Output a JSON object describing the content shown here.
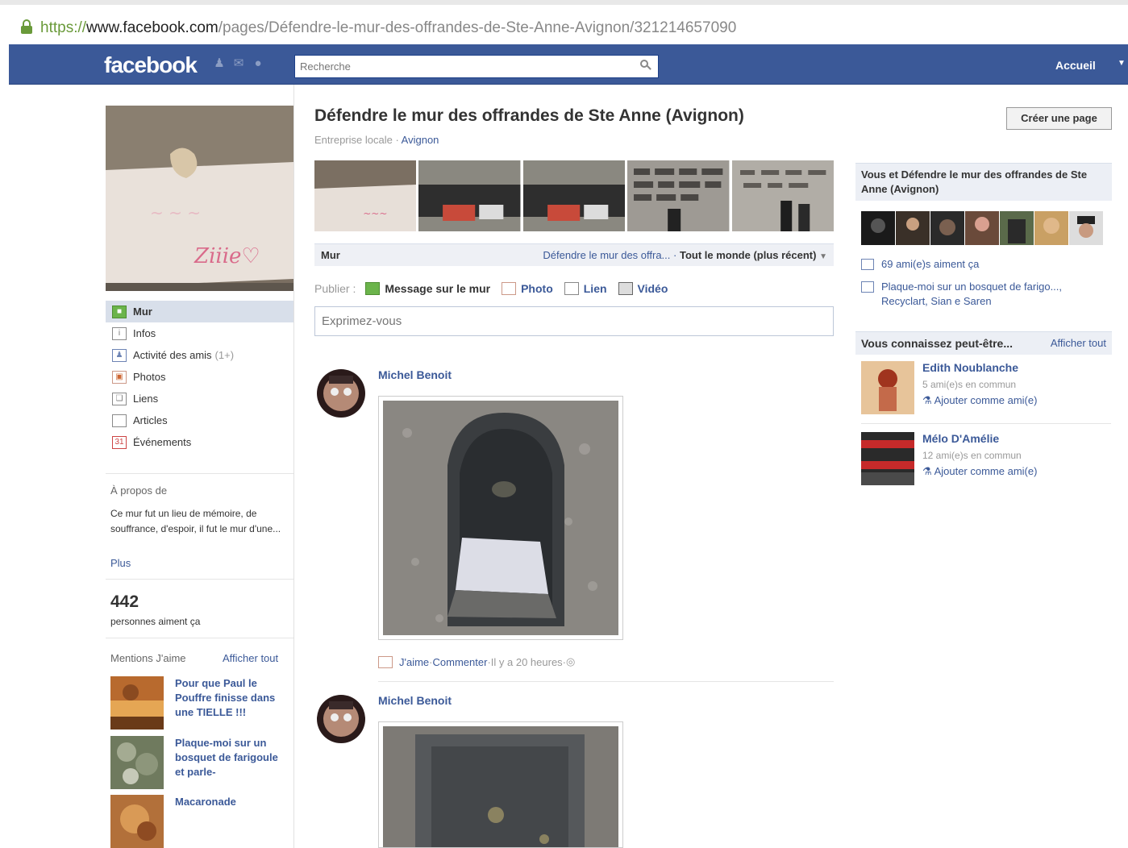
{
  "browser": {
    "url_scheme": "https://",
    "url_host": "www.facebook.com",
    "url_path": "/pages/Défendre-le-mur-des-offrandes-de-Ste-Anne-Avignon/321214657090"
  },
  "header": {
    "logo": "facebook",
    "search_placeholder": "Recherche",
    "home_label": "Accueil"
  },
  "left_nav": [
    {
      "label": "Mur",
      "icon": "wall-icon",
      "count": ""
    },
    {
      "label": "Infos",
      "icon": "info-icon",
      "count": ""
    },
    {
      "label": "Activité des amis",
      "icon": "friends-icon",
      "count": "(1+)"
    },
    {
      "label": "Photos",
      "icon": "photos-icon",
      "count": ""
    },
    {
      "label": "Liens",
      "icon": "links-icon",
      "count": ""
    },
    {
      "label": "Articles",
      "icon": "notes-icon",
      "count": ""
    },
    {
      "label": "Événements",
      "icon": "events-icon",
      "count": ""
    }
  ],
  "about": {
    "title": "À propos de",
    "text": "Ce mur fut un lieu de mémoire, de souffrance, d'espoir, il fut le mur d'une...",
    "more": "Plus"
  },
  "likes": {
    "count": "442",
    "label": "personnes aiment ça"
  },
  "mentions": {
    "title": "Mentions J'aime",
    "see_all": "Afficher tout",
    "items": [
      {
        "title": "Pour que Paul le Pouffre finisse dans une TIELLE !!!"
      },
      {
        "title": "Plaque-moi sur un bosquet de farigoule et parle-"
      },
      {
        "title": "Macaronade"
      }
    ]
  },
  "page": {
    "title": "Défendre le mur des offrandes de Ste Anne (Avignon)",
    "category": "Entreprise locale",
    "sep": " · ",
    "city": "Avignon",
    "create_page": "Créer une page"
  },
  "wall": {
    "tab": "Mur",
    "filter_link": "Défendre le mur des offra...",
    "filter_sep": " · ",
    "filter_current": "Tout le monde (plus récent)",
    "publish_label": "Publier :",
    "publish_options": [
      "Message sur le mur",
      "Photo",
      "Lien",
      "Vidéo"
    ],
    "composer_placeholder": "Exprimez-vous"
  },
  "posts": [
    {
      "author": "Michel Benoit",
      "like": "J'aime",
      "comment": "Commenter",
      "time": "Il y a 20 heures",
      "sep": " · "
    },
    {
      "author": "Michel Benoit"
    }
  ],
  "right": {
    "you_and_page": "Vous et Défendre le mur des offrandes de Ste Anne (Avignon)",
    "friends_like": "69 ami(e)s aiment ça",
    "liked_page": "Plaque-moi sur un bosquet de farigo..., Recyclart, Sian e Saren",
    "suggest_title": "Vous connaissez peut-être...",
    "suggest_see_all": "Afficher tout",
    "suggestions": [
      {
        "name": "Edith Noublanche",
        "mutual": "5 ami(e)s en commun",
        "add": "Ajouter comme ami(e)"
      },
      {
        "name": "Mélo D'Amélie",
        "mutual": "12 ami(e)s en commun",
        "add": "Ajouter comme ami(e)"
      }
    ]
  },
  "colors": {
    "fb_blue": "#3b5998",
    "nav_active": "#d8dfea",
    "link": "#3b5998"
  }
}
